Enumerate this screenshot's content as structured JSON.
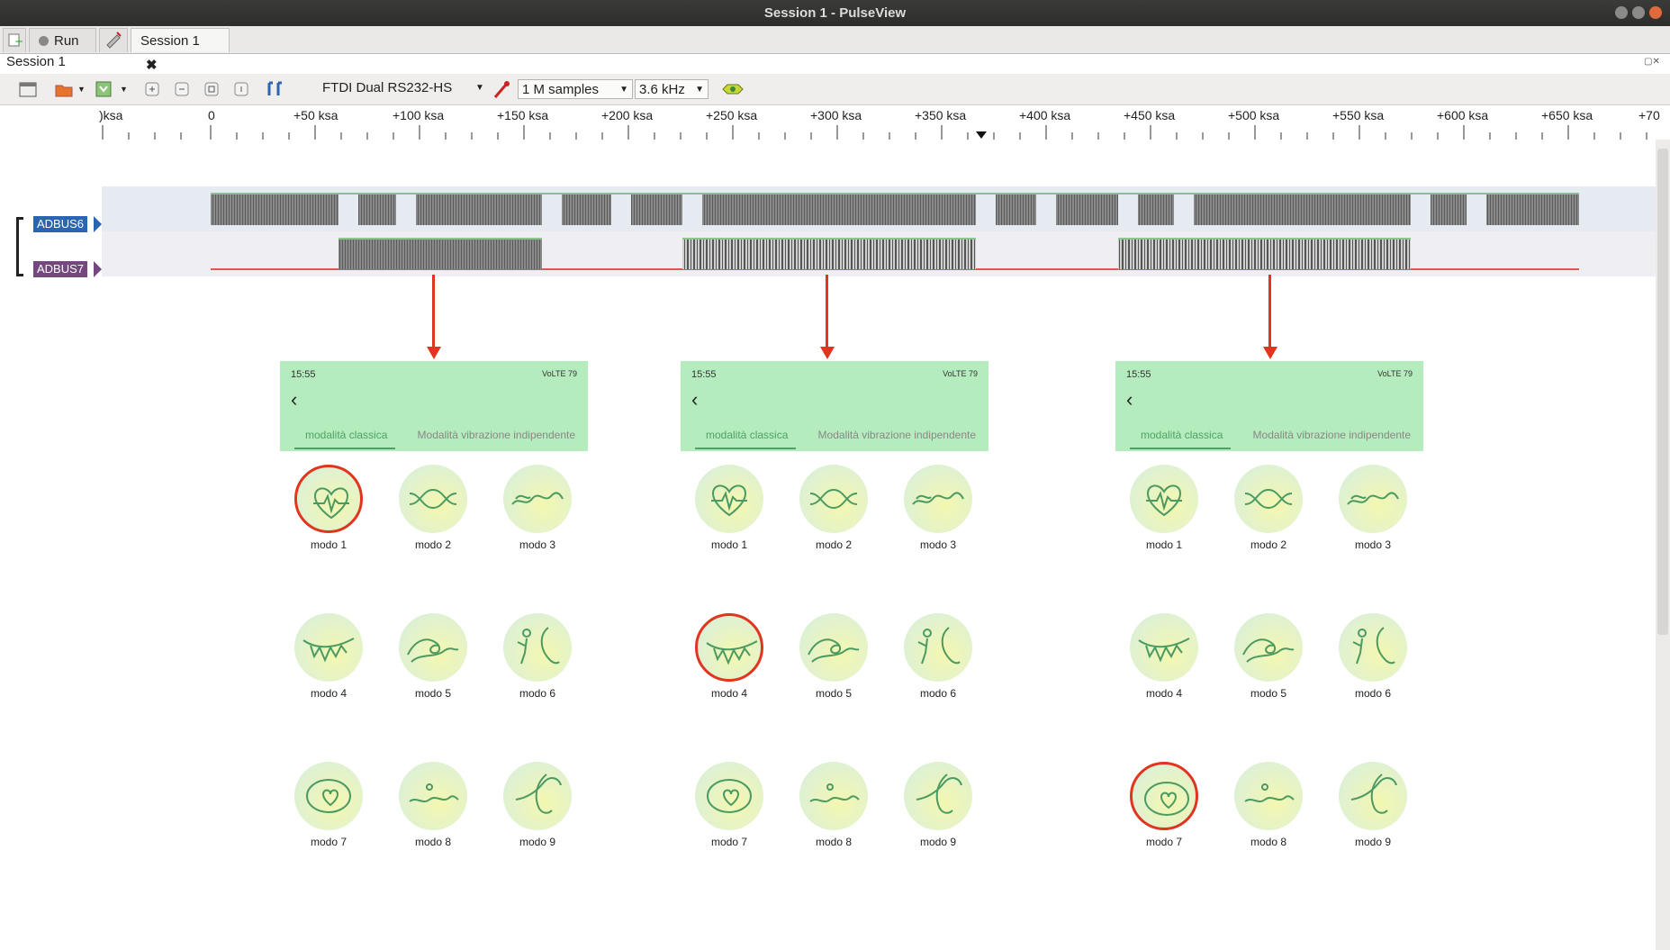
{
  "window": {
    "title": "Session 1 - PulseView"
  },
  "tabs": {
    "run_label": "Run",
    "session_label": "Session 1"
  },
  "session_header": "Session 1",
  "toolbar": {
    "device": "FTDI Dual RS232-HS",
    "samples": "1 M samples",
    "samplerate": "3.6 kHz"
  },
  "ruler": {
    "labels": [
      ")ksa",
      "0",
      "+50 ksa",
      "+100 ksa",
      "+150 ksa",
      "+200 ksa",
      "+250 ksa",
      "+300 ksa",
      "+350 ksa",
      "+400 ksa",
      "+450 ksa",
      "+500 ksa",
      "+550 ksa",
      "+600 ksa",
      "+650 ksa",
      "+70"
    ]
  },
  "channels": [
    {
      "name": "ADBUS6",
      "color": "#2b64b0"
    },
    {
      "name": "ADBUS7",
      "color": "#74487e"
    }
  ],
  "colors": {
    "accent_red": "#e0351e",
    "phone_green": "#b5ecbd",
    "tab_green": "#4ea164"
  },
  "phones": [
    {
      "time": "15:55",
      "status": "VoLTE 79",
      "tab_active": "modalità classica",
      "tab_inactive": "Modalità vibrazione indipendente",
      "selected": "modo 1"
    },
    {
      "time": "15:55",
      "status": "VoLTE 79",
      "tab_active": "modalità classica",
      "tab_inactive": "Modalità vibrazione indipendente",
      "selected": "modo 4"
    },
    {
      "time": "15:55",
      "status": "VoLTE 79",
      "tab_active": "modalità classica",
      "tab_inactive": "Modalità vibrazione indipendente",
      "selected": "modo 7"
    }
  ],
  "modes": [
    "modo 1",
    "modo 2",
    "modo 3",
    "modo 4",
    "modo 5",
    "modo 6",
    "modo 7",
    "modo 8",
    "modo 9"
  ]
}
